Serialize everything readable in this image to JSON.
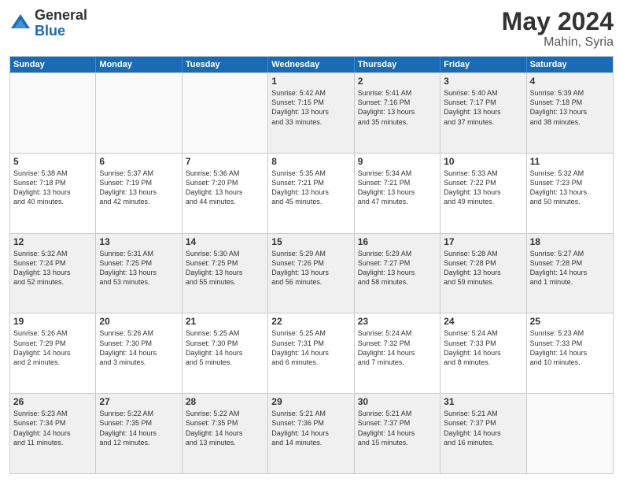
{
  "logo": {
    "general": "General",
    "blue": "Blue"
  },
  "header": {
    "month_year": "May 2024",
    "location": "Mahin, Syria"
  },
  "weekdays": [
    "Sunday",
    "Monday",
    "Tuesday",
    "Wednesday",
    "Thursday",
    "Friday",
    "Saturday"
  ],
  "rows": [
    [
      {
        "day": "",
        "lines": [],
        "empty": true
      },
      {
        "day": "",
        "lines": [],
        "empty": true
      },
      {
        "day": "",
        "lines": [],
        "empty": true
      },
      {
        "day": "1",
        "lines": [
          "Sunrise: 5:42 AM",
          "Sunset: 7:15 PM",
          "Daylight: 13 hours",
          "and 33 minutes."
        ],
        "empty": false
      },
      {
        "day": "2",
        "lines": [
          "Sunrise: 5:41 AM",
          "Sunset: 7:16 PM",
          "Daylight: 13 hours",
          "and 35 minutes."
        ],
        "empty": false
      },
      {
        "day": "3",
        "lines": [
          "Sunrise: 5:40 AM",
          "Sunset: 7:17 PM",
          "Daylight: 13 hours",
          "and 37 minutes."
        ],
        "empty": false
      },
      {
        "day": "4",
        "lines": [
          "Sunrise: 5:39 AM",
          "Sunset: 7:18 PM",
          "Daylight: 13 hours",
          "and 38 minutes."
        ],
        "empty": false
      }
    ],
    [
      {
        "day": "5",
        "lines": [
          "Sunrise: 5:38 AM",
          "Sunset: 7:18 PM",
          "Daylight: 13 hours",
          "and 40 minutes."
        ],
        "empty": false
      },
      {
        "day": "6",
        "lines": [
          "Sunrise: 5:37 AM",
          "Sunset: 7:19 PM",
          "Daylight: 13 hours",
          "and 42 minutes."
        ],
        "empty": false
      },
      {
        "day": "7",
        "lines": [
          "Sunrise: 5:36 AM",
          "Sunset: 7:20 PM",
          "Daylight: 13 hours",
          "and 44 minutes."
        ],
        "empty": false
      },
      {
        "day": "8",
        "lines": [
          "Sunrise: 5:35 AM",
          "Sunset: 7:21 PM",
          "Daylight: 13 hours",
          "and 45 minutes."
        ],
        "empty": false
      },
      {
        "day": "9",
        "lines": [
          "Sunrise: 5:34 AM",
          "Sunset: 7:21 PM",
          "Daylight: 13 hours",
          "and 47 minutes."
        ],
        "empty": false
      },
      {
        "day": "10",
        "lines": [
          "Sunrise: 5:33 AM",
          "Sunset: 7:22 PM",
          "Daylight: 13 hours",
          "and 49 minutes."
        ],
        "empty": false
      },
      {
        "day": "11",
        "lines": [
          "Sunrise: 5:32 AM",
          "Sunset: 7:23 PM",
          "Daylight: 13 hours",
          "and 50 minutes."
        ],
        "empty": false
      }
    ],
    [
      {
        "day": "12",
        "lines": [
          "Sunrise: 5:32 AM",
          "Sunset: 7:24 PM",
          "Daylight: 13 hours",
          "and 52 minutes."
        ],
        "empty": false
      },
      {
        "day": "13",
        "lines": [
          "Sunrise: 5:31 AM",
          "Sunset: 7:25 PM",
          "Daylight: 13 hours",
          "and 53 minutes."
        ],
        "empty": false
      },
      {
        "day": "14",
        "lines": [
          "Sunrise: 5:30 AM",
          "Sunset: 7:25 PM",
          "Daylight: 13 hours",
          "and 55 minutes."
        ],
        "empty": false
      },
      {
        "day": "15",
        "lines": [
          "Sunrise: 5:29 AM",
          "Sunset: 7:26 PM",
          "Daylight: 13 hours",
          "and 56 minutes."
        ],
        "empty": false
      },
      {
        "day": "16",
        "lines": [
          "Sunrise: 5:29 AM",
          "Sunset: 7:27 PM",
          "Daylight: 13 hours",
          "and 58 minutes."
        ],
        "empty": false
      },
      {
        "day": "17",
        "lines": [
          "Sunrise: 5:28 AM",
          "Sunset: 7:28 PM",
          "Daylight: 13 hours",
          "and 59 minutes."
        ],
        "empty": false
      },
      {
        "day": "18",
        "lines": [
          "Sunrise: 5:27 AM",
          "Sunset: 7:28 PM",
          "Daylight: 14 hours",
          "and 1 minute."
        ],
        "empty": false
      }
    ],
    [
      {
        "day": "19",
        "lines": [
          "Sunrise: 5:26 AM",
          "Sunset: 7:29 PM",
          "Daylight: 14 hours",
          "and 2 minutes."
        ],
        "empty": false
      },
      {
        "day": "20",
        "lines": [
          "Sunrise: 5:26 AM",
          "Sunset: 7:30 PM",
          "Daylight: 14 hours",
          "and 3 minutes."
        ],
        "empty": false
      },
      {
        "day": "21",
        "lines": [
          "Sunrise: 5:25 AM",
          "Sunset: 7:30 PM",
          "Daylight: 14 hours",
          "and 5 minutes."
        ],
        "empty": false
      },
      {
        "day": "22",
        "lines": [
          "Sunrise: 5:25 AM",
          "Sunset: 7:31 PM",
          "Daylight: 14 hours",
          "and 6 minutes."
        ],
        "empty": false
      },
      {
        "day": "23",
        "lines": [
          "Sunrise: 5:24 AM",
          "Sunset: 7:32 PM",
          "Daylight: 14 hours",
          "and 7 minutes."
        ],
        "empty": false
      },
      {
        "day": "24",
        "lines": [
          "Sunrise: 5:24 AM",
          "Sunset: 7:33 PM",
          "Daylight: 14 hours",
          "and 8 minutes."
        ],
        "empty": false
      },
      {
        "day": "25",
        "lines": [
          "Sunrise: 5:23 AM",
          "Sunset: 7:33 PM",
          "Daylight: 14 hours",
          "and 10 minutes."
        ],
        "empty": false
      }
    ],
    [
      {
        "day": "26",
        "lines": [
          "Sunrise: 5:23 AM",
          "Sunset: 7:34 PM",
          "Daylight: 14 hours",
          "and 11 minutes."
        ],
        "empty": false
      },
      {
        "day": "27",
        "lines": [
          "Sunrise: 5:22 AM",
          "Sunset: 7:35 PM",
          "Daylight: 14 hours",
          "and 12 minutes."
        ],
        "empty": false
      },
      {
        "day": "28",
        "lines": [
          "Sunrise: 5:22 AM",
          "Sunset: 7:35 PM",
          "Daylight: 14 hours",
          "and 13 minutes."
        ],
        "empty": false
      },
      {
        "day": "29",
        "lines": [
          "Sunrise: 5:21 AM",
          "Sunset: 7:36 PM",
          "Daylight: 14 hours",
          "and 14 minutes."
        ],
        "empty": false
      },
      {
        "day": "30",
        "lines": [
          "Sunrise: 5:21 AM",
          "Sunset: 7:37 PM",
          "Daylight: 14 hours",
          "and 15 minutes."
        ],
        "empty": false
      },
      {
        "day": "31",
        "lines": [
          "Sunrise: 5:21 AM",
          "Sunset: 7:37 PM",
          "Daylight: 14 hours",
          "and 16 minutes."
        ],
        "empty": false
      },
      {
        "day": "",
        "lines": [],
        "empty": true
      }
    ]
  ]
}
